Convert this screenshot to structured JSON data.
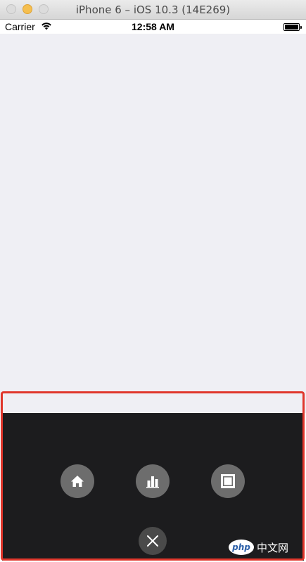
{
  "window": {
    "title": "iPhone 6 – iOS 10.3 (14E269)"
  },
  "status_bar": {
    "carrier": "Carrier",
    "time": "12:58 AM",
    "battery_level": 1.0
  },
  "menu": {
    "items": [
      {
        "icon": "home-icon"
      },
      {
        "icon": "bar-chart-icon"
      },
      {
        "icon": "square-frame-icon"
      }
    ],
    "close_icon": "close-icon"
  },
  "watermark": {
    "text": "中文网",
    "logo_text": "php"
  },
  "colors": {
    "content_background": "#efeff4",
    "menu_background": "#1c1c1e",
    "menu_button": "#6d6d6d",
    "close_button": "#4a4a4a",
    "highlight_border": "#e0362b"
  }
}
